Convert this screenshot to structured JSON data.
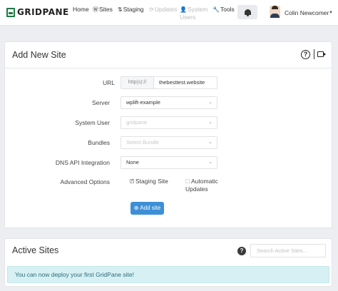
{
  "brand": {
    "name": "GRIDPANE"
  },
  "nav": {
    "items": [
      {
        "label": "Home",
        "icon": ""
      },
      {
        "label": "Sites",
        "icon": "wordpress-icon"
      },
      {
        "label": "Staging",
        "icon": "staging-icon"
      },
      {
        "label": "Updates",
        "icon": "updates-icon",
        "disabled": true
      },
      {
        "label": "System Users",
        "icon": "user-icon",
        "disabled": true
      },
      {
        "label": "Tools",
        "icon": "wrench-icon"
      }
    ],
    "username": "Colin Newcomer"
  },
  "add_site": {
    "title": "Add New Site",
    "url_label": "URL",
    "url_prefix": "http(s)://",
    "url_value": "thebesttest.website",
    "server_label": "Server",
    "server_value": "wplift-example",
    "system_user_label": "System User",
    "system_user_placeholder": "gridpane",
    "bundles_label": "Bundles",
    "bundles_placeholder": "Select Bundle",
    "dns_label": "DNS API Integration",
    "dns_value": "None",
    "advanced_label": "Advanced Options",
    "staging_label": "Staging Site",
    "staging_checked": true,
    "auto_updates_label": "Automatic Updates",
    "auto_updates_checked": false,
    "submit_label": "Add site"
  },
  "active_sites": {
    "title": "Active Sites",
    "search_placeholder": "Search Active Sites...",
    "alert": "You can now deploy your first GridPane site!"
  },
  "colors": {
    "brand_green": "#1e7a43",
    "primary": "#3d8fd6",
    "alert_bg": "#d6f0f3"
  }
}
